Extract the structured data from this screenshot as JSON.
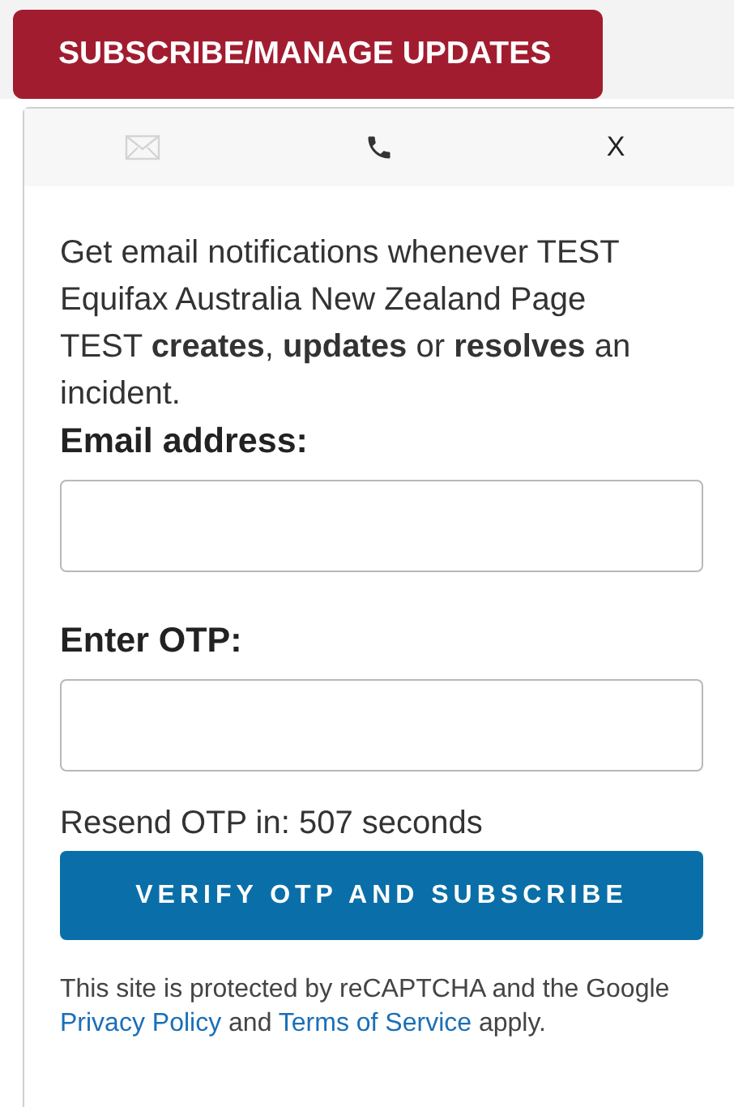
{
  "header_button": {
    "label": "SUBSCRIBE/MANAGE UPDATES"
  },
  "tabs": [
    {
      "kind": "email",
      "selected": true
    },
    {
      "kind": "phone",
      "selected": false
    },
    {
      "kind": "close",
      "label": "X",
      "selected": false
    }
  ],
  "description": "Get email notifications whenever TEST Equifax Australia New Zealand Page TEST **creates**, **updates** or **resolves** an incident.",
  "fields": [
    {
      "label": "Email address:"
    },
    {
      "label": "Enter OTP:"
    }
  ],
  "resend_text": "Resend OTP in: 507 seconds",
  "submit_button": {
    "label": "VERIFY OTP AND SUBSCRIBE"
  },
  "recaptcha": {
    "text_before": "This site is protected by reCAPTCHA and the Google",
    "privacy_link": "Privacy Policy",
    "text_middle": "and",
    "terms_link": "Terms of Service",
    "text_after": "apply."
  }
}
